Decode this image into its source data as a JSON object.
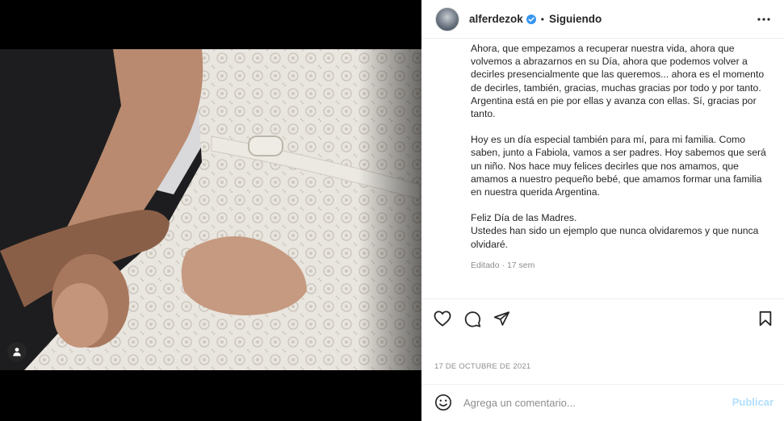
{
  "post": {
    "username": "alferdezok",
    "separator": "•",
    "follow_status": "Siguiendo",
    "caption_paragraphs": [
      "Ahora, que empezamos a recuperar nuestra vida, ahora que volvemos a abrazarnos en su Día, ahora que podemos volver a decirles presencialmente que las queremos... ahora es el momento de decirles, también, gracias, muchas gracias por todo y por tanto. Argentina está en pie por ellas y avanza con ellas. Sí, gracias por tanto.",
      "Hoy es un día especial también para mí, para mi familia. Como saben, junto a Fabiola, vamos a ser padres. Hoy sabemos que será un niño. Nos hace muy felices decirles que nos amamos, que amamos a nuestro pequeño bebé, que amamos formar una familia en nuestra querida Argentina.",
      "Feliz Día de las Madres.\nUstedes han sido un ejemplo que nunca olvidaremos y que nunca olvidaré."
    ],
    "edited_meta": "Editado · 17 sem",
    "date": "17 DE OCTUBRE DE 2021"
  },
  "comment_box": {
    "placeholder": "Agrega un comentario...",
    "publish_label": "Publicar"
  },
  "icons": {
    "more": "more-options-icon",
    "like": "heart-icon",
    "comment": "comment-icon",
    "share": "share-icon",
    "save": "bookmark-icon",
    "emoji": "emoji-icon",
    "tags": "user-tag-icon",
    "verified": "verified-badge-icon"
  },
  "colors": {
    "verified": "#3897f0",
    "publish_disabled": "#b2dffc",
    "muted_text": "#8e8e8e"
  }
}
